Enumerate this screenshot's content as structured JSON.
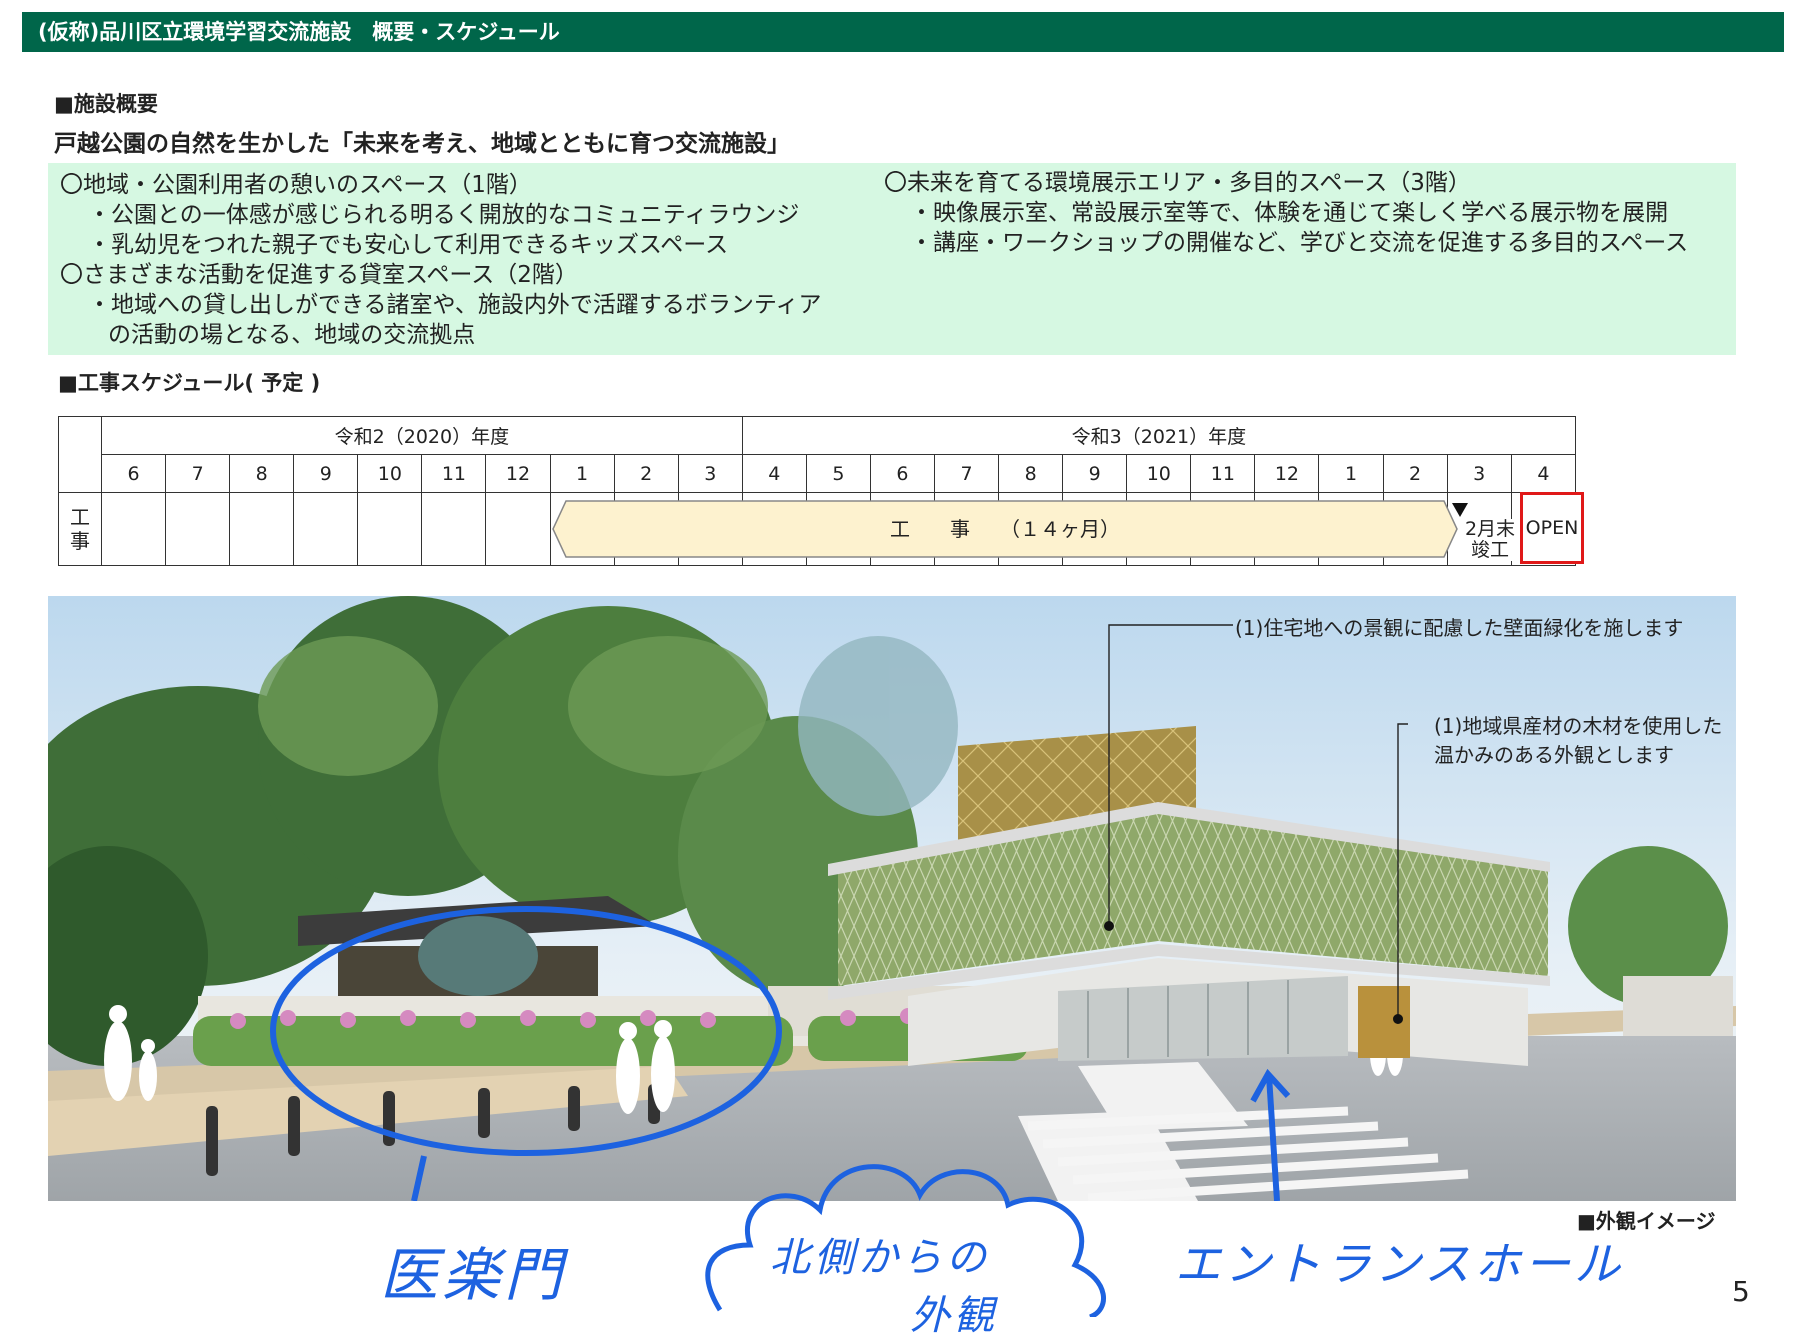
{
  "header": {
    "title": "(仮称)品川区立環境学習交流施設　概要・スケジュール"
  },
  "overview": {
    "heading": "■施設概要",
    "tagline": "戸越公園の自然を生かした「未来を考え、地域とともに育つ交流施設」",
    "left": [
      "〇地域・公園利用者の憩いのスペース（1階）",
      "・公園との一体感が感じられる明るく開放的なコミュニティラウンジ",
      "・乳幼児をつれた親子でも安心して利用できるキッズスペース",
      "〇さまざまな活動を促進する貸室スペース（2階）",
      "・地域への貸し出しができる諸室や、施設内外で活躍するボランティア",
      "の活動の場となる、地域の交流拠点"
    ],
    "right": [
      "〇未来を育てる環境展示エリア・多目的スペース（3階）",
      "・映像展示室、常設展示室等で、体験を通じて楽しく学べる展示物を展開",
      "・講座・ワークショップの開催など、学びと交流を促進する多目的スペース"
    ]
  },
  "schedule": {
    "heading": "■工事スケジュール( 予定 )",
    "years": [
      "令和2（2020）年度",
      "令和3（2021）年度"
    ],
    "months": [
      "6",
      "7",
      "8",
      "9",
      "10",
      "11",
      "12",
      "1",
      "2",
      "3",
      "4",
      "5",
      "6",
      "7",
      "8",
      "9",
      "10",
      "11",
      "12",
      "1",
      "2",
      "3",
      "4"
    ],
    "row_label": "工事",
    "bar_label": "工　　事　　（１４ヶ月）",
    "completion": "2月末竣工",
    "completion_line1": "2月末",
    "completion_line2": "竣工",
    "open": "OPEN"
  },
  "photo": {
    "callout1": "(1)住宅地への景観に配慮した壁面緑化を施します",
    "callout2_line1": "(1)地域県産材の木材を使用した",
    "callout2_line2": "温かみのある外観とします",
    "caption": "■外観イメージ"
  },
  "handwriting": {
    "gate": "医楽門",
    "north_view_line1": "北側からの",
    "north_view_line2": "外観",
    "entrance": "エントランスホール"
  },
  "page_number": "5",
  "colors": {
    "header_bg": "#00664a",
    "overview_bg": "#d6f8e2",
    "bar_fill": "#fdf2cf",
    "open_border": "#e01818",
    "annotation": "#1d62e0"
  }
}
